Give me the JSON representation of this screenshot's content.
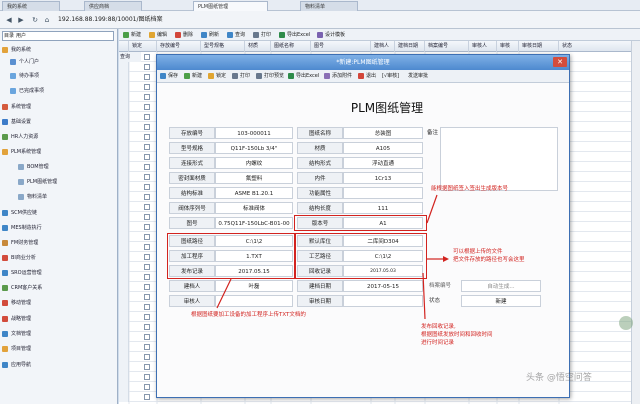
{
  "tabs": [
    {
      "label": "我的系统"
    },
    {
      "label": "供应商档"
    },
    {
      "label": "PLM图纸管理"
    },
    {
      "label": "物料清单"
    }
  ],
  "address": {
    "url": "192.168.88.199:88/10001/图纸档案"
  },
  "sidebar": {
    "search_label": "目录",
    "search_value": "用户",
    "items": [
      {
        "label": "我的系统"
      },
      {
        "label": "个人门户"
      },
      {
        "label": "待办事项"
      },
      {
        "label": "已完成事项"
      },
      {
        "label": "系统管理"
      },
      {
        "label": "基础设置"
      },
      {
        "label": "HR人力资源"
      },
      {
        "label": "PLM系统管理"
      },
      {
        "label": "BOM管理"
      },
      {
        "label": "PLM图纸管理"
      },
      {
        "label": "物料清单"
      },
      {
        "label": "SCM供应链"
      },
      {
        "label": "MES制造执行"
      },
      {
        "label": "FM财务管理"
      },
      {
        "label": "BI商业分析"
      },
      {
        "label": "SRO运营管理"
      },
      {
        "label": "CRM客户关系"
      },
      {
        "label": "移动管理"
      },
      {
        "label": "战略管理"
      },
      {
        "label": "文档管理"
      },
      {
        "label": "项目管理"
      },
      {
        "label": "应用导航"
      }
    ]
  },
  "toolbar": {
    "items": [
      {
        "label": "新建"
      },
      {
        "label": "编辑"
      },
      {
        "label": "删除"
      },
      {
        "label": "刷新"
      },
      {
        "label": "查询"
      },
      {
        "label": "打印"
      },
      {
        "label": "导出Excel"
      },
      {
        "label": "设计模板"
      }
    ]
  },
  "grid": {
    "headers": [
      "",
      "锁定",
      "存放编号",
      "型号规格",
      "材质",
      "图纸名称",
      "图号",
      "建档人",
      "建档日期",
      "档案编号",
      "审核人",
      "审核",
      "审核日期",
      "状态"
    ],
    "first_row_label": "查询"
  },
  "dialog": {
    "title": "*新建:PLM图纸管理",
    "toolbar": [
      {
        "label": "保存"
      },
      {
        "label": "新建"
      },
      {
        "label": "锁定"
      },
      {
        "label": "打印"
      },
      {
        "label": "打印预览"
      },
      {
        "label": "导出Excel"
      },
      {
        "label": "添加附件"
      },
      {
        "label": "退出"
      },
      {
        "label": "[√审核]"
      },
      {
        "label": "发送审批"
      }
    ],
    "heading": "PLM图纸管理",
    "fields": {
      "storage_no_label": "存放编号",
      "storage_no": "103-000011",
      "drawing_name_label": "图纸名称",
      "drawing_name": "总装图",
      "remark_label": "备注",
      "model_label": "型号规格",
      "model": "Q11F-150Lb 3/4\"",
      "material_label": "材质",
      "material": "A105",
      "connection_label": "连接形式",
      "connection": "内螺纹",
      "structure_label": "结构形式",
      "structure": "浮动直通",
      "seal_label": "密封面材质",
      "seal": "氟塑料",
      "inner_label": "内件",
      "inner": "1Cr13",
      "standard_label": "结构标准",
      "standard": "ASME B1.20.1",
      "function_label": "功能属性",
      "function": "",
      "series_label": "阀体序列号",
      "series": "标准阀体",
      "length_label": "结构长度",
      "length": "111",
      "drawing_no_label": "图号",
      "drawing_no": "0.75Q11F-150LbC-B01-00",
      "version_label": "版本号",
      "version": "A1",
      "drawing_path_label": "图纸路径",
      "drawing_path": "C:\\1\\2",
      "default_location_label": "默认库位",
      "default_location": "二库间D304",
      "process_label": "加工程序",
      "process": "1.TXT",
      "process_path_label": "工艺路径",
      "process_path": "C:\\1\\2",
      "release_label": "发布记录",
      "release": "2017.05.15",
      "recycle_label": "回收记录",
      "recycle": "2017.05.03",
      "creator_label": "建档人",
      "creator": "叶磊",
      "create_date_label": "建档日期",
      "create_date": "2017-05-15",
      "reviewer_label": "审核人",
      "reviewer": "",
      "review_date_label": "审核日期",
      "review_date": "",
      "status_label": "状态",
      "status": "新建",
      "archive_no_label": "档案编号",
      "archive_no": "自动生成..."
    }
  },
  "annotations": {
    "version_note": "能根据图纸签入签出生成版本号",
    "path_note_line1": "可以根据上传的文件",
    "path_note_line2": "把文件存放的路径也写会这里",
    "process_note": "根据图纸要加工设备的加工程序上传TXT文档的",
    "record_note_line1": "发布回收记录,",
    "record_note_line2": "根据图纸发放时间和回收时间",
    "record_note_line3": "进行时间记录"
  },
  "watermark": {
    "text": "头条 @悟空问答"
  },
  "colors": {
    "accent": "#4d89cf",
    "annotation": "#d2231f",
    "background": "#cfdcec"
  }
}
